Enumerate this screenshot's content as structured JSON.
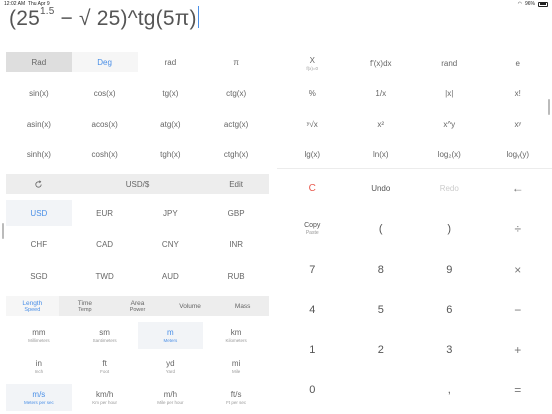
{
  "status": {
    "time": "12:02 AM",
    "date": "Thu Apr 9",
    "battery": "96%"
  },
  "expression": {
    "base": "(25",
    "exp": "1.5",
    "rest": " − √ 25)^tg(5π)"
  },
  "angle_modes": [
    "Rad",
    "Deg",
    "rad",
    "π"
  ],
  "sci": [
    [
      "sin(x)",
      "cos(x)",
      "tg(x)",
      "ctg(x)"
    ],
    [
      "asin(x)",
      "acos(x)",
      "atg(x)",
      "actg(x)"
    ],
    [
      "sinh(x)",
      "cosh(x)",
      "tgh(x)",
      "ctgh(x)"
    ]
  ],
  "right_funcs": [
    [
      {
        "t": "X",
        "s": "f(x)=0"
      },
      {
        "t": "f'(x)dx",
        "s": ""
      },
      {
        "t": "rand",
        "s": ""
      },
      {
        "t": "e",
        "s": ""
      }
    ],
    [
      {
        "t": "%",
        "s": ""
      },
      {
        "t": "1/x",
        "s": ""
      },
      {
        "t": "|x|",
        "s": ""
      },
      {
        "t": "x!",
        "s": ""
      }
    ],
    [
      {
        "t": "ʸ√x",
        "s": ""
      },
      {
        "t": "x²",
        "s": ""
      },
      {
        "t": "x^y",
        "s": ""
      },
      {
        "t": "xʸ",
        "s": ""
      }
    ],
    [
      {
        "t": "lg(x)",
        "s": ""
      },
      {
        "t": "ln(x)",
        "s": ""
      },
      {
        "t": "log₂(x)",
        "s": ""
      },
      {
        "t": "logᵧ(y)",
        "s": ""
      }
    ]
  ],
  "converter_bar": {
    "from": "USD/$",
    "edit": "Edit"
  },
  "currencies": [
    [
      "USD",
      "EUR",
      "JPY",
      "GBP"
    ],
    [
      "CHF",
      "CAD",
      "CNY",
      "INR"
    ],
    [
      "SGD",
      "TWD",
      "AUD",
      "RUB"
    ]
  ],
  "unit_tabs": [
    {
      "t": "Length",
      "s": "Speed"
    },
    {
      "t": "Time",
      "s": "Temp"
    },
    {
      "t": "Area",
      "s": "Power"
    },
    {
      "t": "Volume",
      "s": ""
    },
    {
      "t": "Mass",
      "s": ""
    }
  ],
  "units": [
    [
      {
        "t": "mm",
        "s": "Millimeters"
      },
      {
        "t": "sm",
        "s": "Santimeters"
      },
      {
        "t": "m",
        "s": "Meters"
      },
      {
        "t": "km",
        "s": "Kilometers"
      }
    ],
    [
      {
        "t": "in",
        "s": "Inch"
      },
      {
        "t": "ft",
        "s": "Foot"
      },
      {
        "t": "yd",
        "s": "Yard"
      },
      {
        "t": "mi",
        "s": "Mile"
      }
    ],
    [
      {
        "t": "m/s",
        "s": "Meters per sec"
      },
      {
        "t": "km/h",
        "s": "Km per hour"
      },
      {
        "t": "m/h",
        "s": "Mile per hour"
      },
      {
        "t": "ft/s",
        "s": "Ft per sec"
      }
    ]
  ],
  "keypad": {
    "r1": [
      "C",
      "Undo",
      "Redo",
      "←"
    ],
    "r2": [
      {
        "t": "Copy",
        "s": "Paste"
      },
      {
        "t": "(",
        "s": ""
      },
      {
        "t": ")",
        "s": ""
      },
      {
        "t": "÷",
        "s": ""
      }
    ],
    "r3": [
      "7",
      "8",
      "9",
      "×"
    ],
    "r4": [
      "4",
      "5",
      "6",
      "−"
    ],
    "r5": [
      "1",
      "2",
      "3",
      "+"
    ],
    "r6": [
      "0",
      "",
      ",",
      "="
    ]
  }
}
